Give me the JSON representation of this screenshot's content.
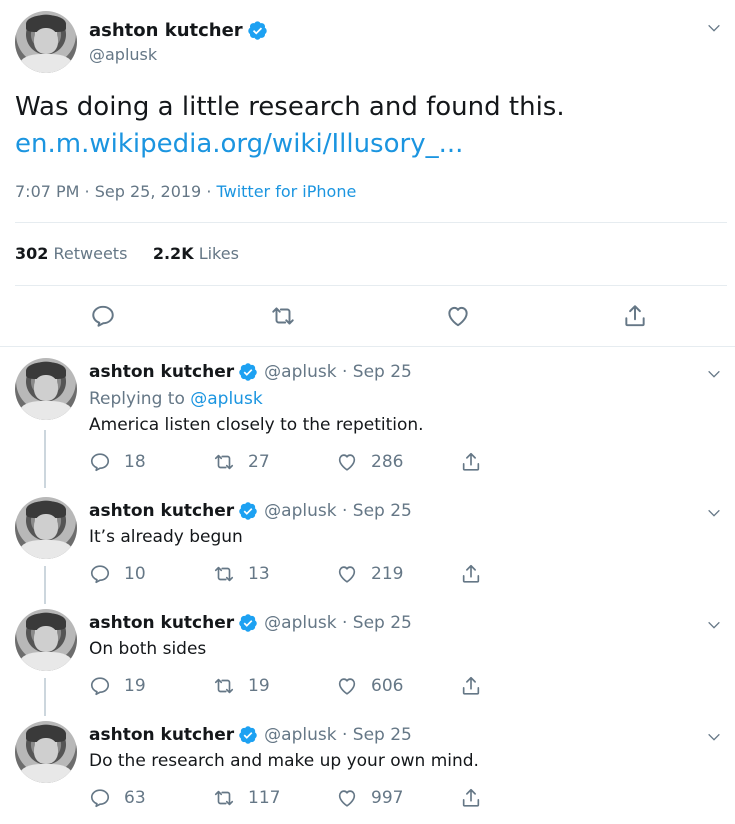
{
  "main_tweet": {
    "author_name": "ashton kutcher",
    "author_handle": "@aplusk",
    "text": "Was doing a little research and found this.",
    "link_text": "en.m.wikipedia.org/wiki/Illusory_...",
    "time": "7:07 PM",
    "separator1": " · ",
    "date": "Sep 25, 2019",
    "separator2": " · ",
    "source": "Twitter for iPhone",
    "retweets_count": "302",
    "retweets_label": "Retweets",
    "likes_count": "2.2K",
    "likes_label": "Likes"
  },
  "replies": [
    {
      "author_name": "ashton kutcher",
      "handle_date": "@aplusk · Sep 25",
      "replying_prefix": "Replying to ",
      "replying_handle": "@aplusk",
      "text": "America listen closely to the repetition.",
      "reply_count": "18",
      "retweet_count": "27",
      "like_count": "286"
    },
    {
      "author_name": "ashton kutcher",
      "handle_date": "@aplusk · Sep 25",
      "text": "It’s already begun",
      "reply_count": "10",
      "retweet_count": "13",
      "like_count": "219"
    },
    {
      "author_name": "ashton kutcher",
      "handle_date": "@aplusk · Sep 25",
      "text": "On both sides",
      "reply_count": "19",
      "retweet_count": "19",
      "like_count": "606"
    },
    {
      "author_name": "ashton kutcher",
      "handle_date": "@aplusk · Sep 25",
      "text": "Do the research and make up your own mind.",
      "reply_count": "63",
      "retweet_count": "117",
      "like_count": "997"
    }
  ],
  "colors": {
    "link": "#1b95e0",
    "muted": "#657786",
    "verified": "#1da1f2",
    "divider": "#e6ecf0"
  },
  "icons": [
    "chevron-down-icon",
    "verified-badge-icon",
    "reply-icon",
    "retweet-icon",
    "like-icon",
    "share-icon"
  ]
}
